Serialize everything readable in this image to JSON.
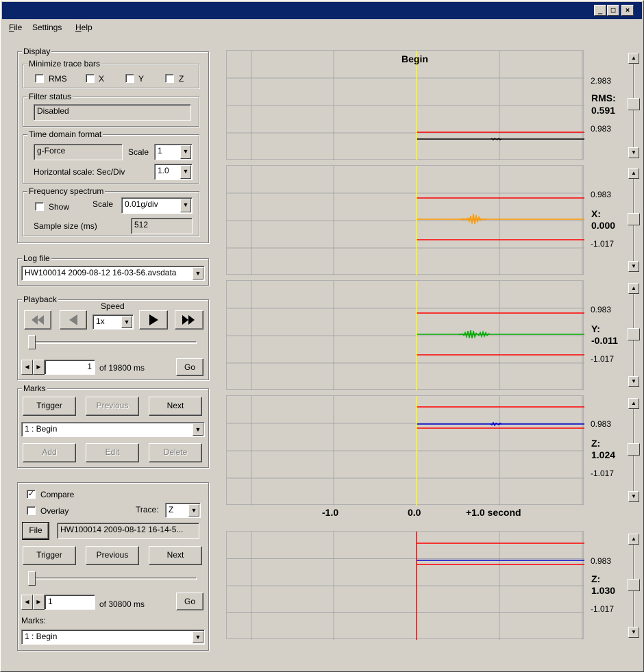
{
  "window": {
    "title_controls": [
      "_",
      "□",
      "×"
    ]
  },
  "menu": [
    {
      "label": "File",
      "mnemonic": "F",
      "rest": "ile"
    },
    {
      "label": "Settings",
      "mnemonic": "",
      "rest": "Settings"
    },
    {
      "label": "Help",
      "mnemonic": "H",
      "rest": "elp"
    }
  ],
  "display": {
    "group_title": "Display",
    "minimize": {
      "title": "Minimize trace bars",
      "options": [
        {
          "label": "RMS",
          "checked": false
        },
        {
          "label": "X",
          "checked": false
        },
        {
          "label": "Y",
          "checked": false
        },
        {
          "label": "Z",
          "checked": false
        }
      ]
    },
    "filter": {
      "title": "Filter status",
      "value": "Disabled"
    },
    "time_domain": {
      "title": "Time domain format",
      "format": "g-Force",
      "scale_label": "Scale",
      "scale_value": "1",
      "hscale_label": "Horizontal scale: Sec/Div",
      "hscale_value": "1.0"
    },
    "freq": {
      "title": "Frequency spectrum",
      "show_label": "Show",
      "show_checked": false,
      "scale_label": "Scale",
      "scale_value": "0.01g/div",
      "sample_label": "Sample size (ms)",
      "sample_value": "512"
    }
  },
  "logfile": {
    "title": "Log file",
    "value": "HW100014 2009-08-12 16-03-56.avsdata"
  },
  "playback": {
    "title": "Playback",
    "speed_label": "Speed",
    "speed_value": "1x",
    "position_value": "1",
    "of_label": "of 19800 ms",
    "go_label": "Go",
    "slider_fraction": 0.0
  },
  "marks": {
    "title": "Marks",
    "trigger": "Trigger",
    "previous": "Previous",
    "next": "Next",
    "selected": "1 : Begin",
    "add": "Add",
    "edit": "Edit",
    "delete": "Delete"
  },
  "compare": {
    "compare_label": "Compare",
    "compare_checked": true,
    "overlay_label": "Overlay",
    "overlay_checked": false,
    "trace_label": "Trace:",
    "trace_value": "Z",
    "file_button": "File",
    "file_value": "HW100014 2009-08-12 16-14-5...",
    "trigger": "Trigger",
    "previous": "Previous",
    "next": "Next",
    "position_value": "1",
    "of_label": "of 30800 ms",
    "go_label": "Go",
    "marks_label": "Marks:",
    "marks_selected": "1 : Begin",
    "slider_fraction": 0.0
  },
  "plots": {
    "begin_label": "Begin",
    "x_axis": {
      "minus": "-1.0",
      "zero": "0.0",
      "plus": "+1.0 second"
    },
    "rms": {
      "top": "2.983",
      "name": "RMS:",
      "value": "0.591",
      "low": "0.983"
    },
    "x": {
      "top": "0.983",
      "name": "X:",
      "value": "0.000",
      "low": "-1.017"
    },
    "y": {
      "top": "0.983",
      "name": "Y:",
      "value": "-0.011",
      "low": "-1.017"
    },
    "z": {
      "top": "0.983",
      "name": "Z:",
      "value": "1.024",
      "low": "-1.017"
    },
    "z2": {
      "top": "0.983",
      "name": "Z:",
      "value": "1.030",
      "low": "-1.017"
    }
  },
  "colors": {
    "rms_trace": "#000000",
    "x_trace": "#ff9900",
    "y_trace": "#00aa00",
    "z_trace": "#0000cc",
    "limit": "#ff0000",
    "marker": "#ffff00",
    "grid": "#a8a8a8"
  }
}
